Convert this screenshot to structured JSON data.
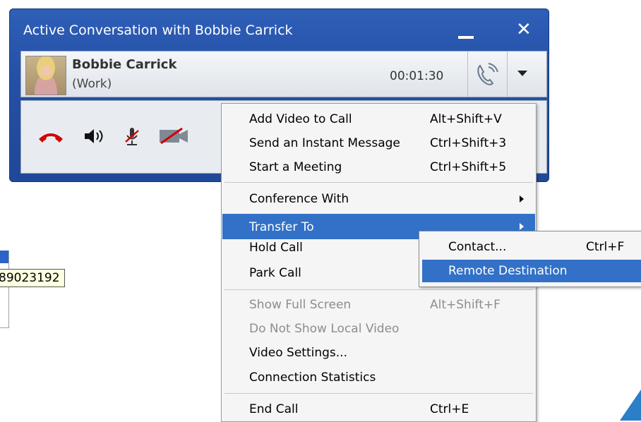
{
  "background": {
    "tooltip_text": "89023192"
  },
  "window": {
    "title": "Active Conversation with Bobbie Carrick",
    "minimize_icon": "minimize-icon",
    "close_label": "✕"
  },
  "caller": {
    "name": "Bobbie Carrick",
    "line": "(Work)",
    "duration": "00:01:30"
  },
  "controls": {
    "icons": [
      "end-call-icon",
      "speaker-icon",
      "mute-mic-icon",
      "video-off-icon"
    ],
    "end_call_color": "#d20000"
  },
  "menu": {
    "items": [
      {
        "label": "Add Video to Call",
        "shortcut": "Alt+Shift+V"
      },
      {
        "label": "Send an Instant Message",
        "shortcut": "Ctrl+Shift+3"
      },
      {
        "label": "Start a Meeting",
        "shortcut": "Ctrl+Shift+5"
      },
      {
        "label": "Conference With",
        "shortcut": ""
      },
      {
        "label": "Transfer To",
        "shortcut": ""
      },
      {
        "label": "Hold Call",
        "shortcut": ""
      },
      {
        "label": "Park Call",
        "shortcut": ""
      },
      {
        "label": "Show Full Screen",
        "shortcut": "Alt+Shift+F"
      },
      {
        "label": "Do Not Show Local Video",
        "shortcut": ""
      },
      {
        "label": "Video Settings...",
        "shortcut": ""
      },
      {
        "label": "Connection Statistics",
        "shortcut": ""
      },
      {
        "label": "End Call",
        "shortcut": "Ctrl+E"
      }
    ]
  },
  "submenu": {
    "items": [
      {
        "label": "Contact...",
        "shortcut": "Ctrl+F"
      },
      {
        "label": "Remote Destination",
        "shortcut": ""
      }
    ]
  },
  "colors": {
    "highlight": "#3271c7",
    "title_bar": "#2550a6"
  }
}
